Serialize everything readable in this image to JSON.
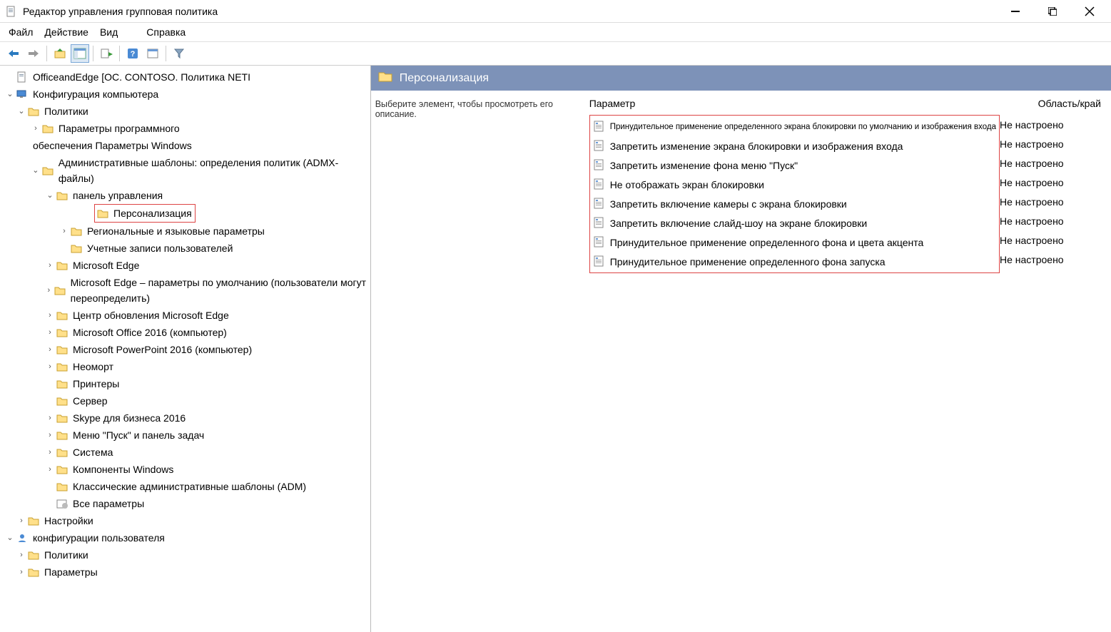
{
  "window": {
    "title": "Редактор управления групповая политика"
  },
  "menu": {
    "file": "Файл",
    "action": "Действие",
    "view": "Вид",
    "help": "Справка"
  },
  "tree": {
    "root": "OfficeandEdge [OC. CONTOSO. Политика NETI",
    "comp_config": "Конфигурация компьютера",
    "policies": "Политики",
    "software_l1": "Параметры программного",
    "software_l2": "обеспечения Параметры Windows",
    "admx": "Административные шаблоны: определения политик (ADMX-файлы)",
    "control_panel": "панель управления",
    "personalization": "Персонализация",
    "regional": "Региональные и языковые параметры",
    "user_accounts": "Учетные записи пользователей",
    "edge": "Microsoft Edge",
    "edge_default": "Microsoft Edge – параметры по умолчанию (пользователи могут переопределить)",
    "edge_update": "Центр обновления Microsoft Edge",
    "office2016": "Microsoft Office 2016 (компьютер)",
    "ppt2016": "Microsoft PowerPoint 2016 (компьютер)",
    "neomort": "Неоморт",
    "printers": "Принтеры",
    "server": "Сервер",
    "skype": "Skype для бизнеса 2016",
    "start_taskbar": "Меню \"Пуск\" и панель задач",
    "system": "Система",
    "win_components": "Компоненты Windows",
    "classic_adm": "Классические административные шаблоны (ADM)",
    "all_settings": "Все параметры",
    "preferences": "Настройки",
    "user_config": "конфигурации пользователя",
    "user_policies": "Политики",
    "user_prefs": "Параметры"
  },
  "content": {
    "header": "Персонализация",
    "description": "Выберите элемент, чтобы просмотреть его описание.",
    "col_param": "Параметр",
    "col_state": "Область/край",
    "settings": [
      {
        "label": "Принудительное применение определенного экрана блокировки по умолчанию и изображения входа",
        "state": "Не настроено",
        "small": true
      },
      {
        "label": "Запретить изменение экрана блокировки и изображения входа",
        "state": "Не настроено"
      },
      {
        "label": "Запретить изменение фона меню \"Пуск\"",
        "state": "Не настроено"
      },
      {
        "label": "Не отображать экран блокировки",
        "state": "Не настроено"
      },
      {
        "label": "Запретить включение камеры с экрана блокировки",
        "state": "Не настроено"
      },
      {
        "label": "Запретить включение слайд-шоу на экране блокировки",
        "state": "Не настроено"
      },
      {
        "label": "Принудительное применение определенного фона и цвета акцента",
        "state": "Не настроено"
      },
      {
        "label": "Принудительное применение определенного фона запуска",
        "state": "Не настроено"
      }
    ]
  }
}
